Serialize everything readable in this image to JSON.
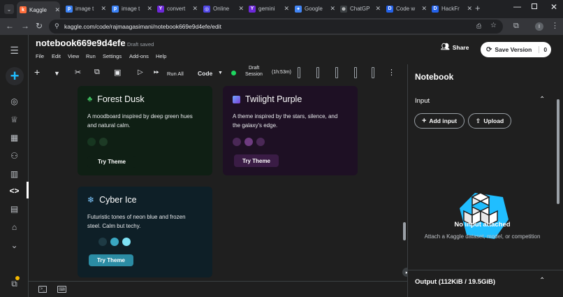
{
  "browser": {
    "tabs": [
      {
        "label": "Kaggle",
        "fav": "k",
        "color": "#ff6d3b"
      },
      {
        "label": "image t",
        "fav": "p",
        "color": "#3b82f6"
      },
      {
        "label": "image t",
        "fav": "p",
        "color": "#3b82f6"
      },
      {
        "label": "convert",
        "fav": "Y",
        "color": "#6d28d9"
      },
      {
        "label": "Online",
        "fav": "◎",
        "color": "#4f46e5"
      },
      {
        "label": "gemini",
        "fav": "Y",
        "color": "#6d28d9"
      },
      {
        "label": "Google",
        "fav": "✦",
        "color": "#4285f4"
      },
      {
        "label": "ChatGP",
        "fav": "⊛",
        "color": "#3c4043"
      },
      {
        "label": "Code w",
        "fav": "D",
        "color": "#2563eb"
      },
      {
        "label": "HackFr",
        "fav": "D",
        "color": "#2563eb"
      }
    ],
    "url": "kaggle.com/code/rajmaagasimani/notebook669e9d4efe/edit"
  },
  "header": {
    "title": "notebook669e9d4efe",
    "draft_status": "Draft saved",
    "menu": [
      "File",
      "Edit",
      "View",
      "Run",
      "Settings",
      "Add-ons",
      "Help"
    ],
    "share_label": "Share",
    "save_version_label": "Save Version",
    "save_version_count": "0"
  },
  "toolbar": {
    "run_all_label": "Run All",
    "cell_type": "Code",
    "session_label_1": "Draft",
    "session_label_2": "Session",
    "session_time": "(1h:53m)"
  },
  "cards": [
    {
      "title": "Forest Dusk",
      "icon": "tree-icon",
      "desc": "A moodboard inspired by deep green hues and natural calm.",
      "button": "Try Theme",
      "bg": "#0f1f14",
      "btn_bg": "#0f1f14",
      "dots": [
        "#173620",
        "#1d3a25"
      ]
    },
    {
      "title": "Twilight Purple",
      "icon": "galaxy-icon",
      "desc": "A theme inspired by the stars, silence, and the galaxy's edge.",
      "button": "Try Theme",
      "bg": "#1e1024",
      "btn_bg": "#3a1c45",
      "dots": [
        "#4a2856",
        "#6e3b80",
        "#4a2856"
      ]
    },
    {
      "title": "Cyber Ice",
      "icon": "snowflake-icon",
      "desc": "Futuristic tones of neon blue and frozen steel. Calm but techy.",
      "button": "Try Theme",
      "bg": "#0e1f27",
      "btn_bg": "#2b8ca4",
      "dots": [
        "#1e3a44",
        "#3aa7c2",
        "#7ee2f5"
      ]
    }
  ],
  "right_panel": {
    "title": "Notebook",
    "input_section": "Input",
    "add_input_label": "Add input",
    "upload_label": "Upload",
    "no_input_title": "No input attached",
    "no_input_desc": "Attach a Kaggle dataset, model, or competition",
    "output_label": "Output (112KiB / 19.5GiB)"
  }
}
